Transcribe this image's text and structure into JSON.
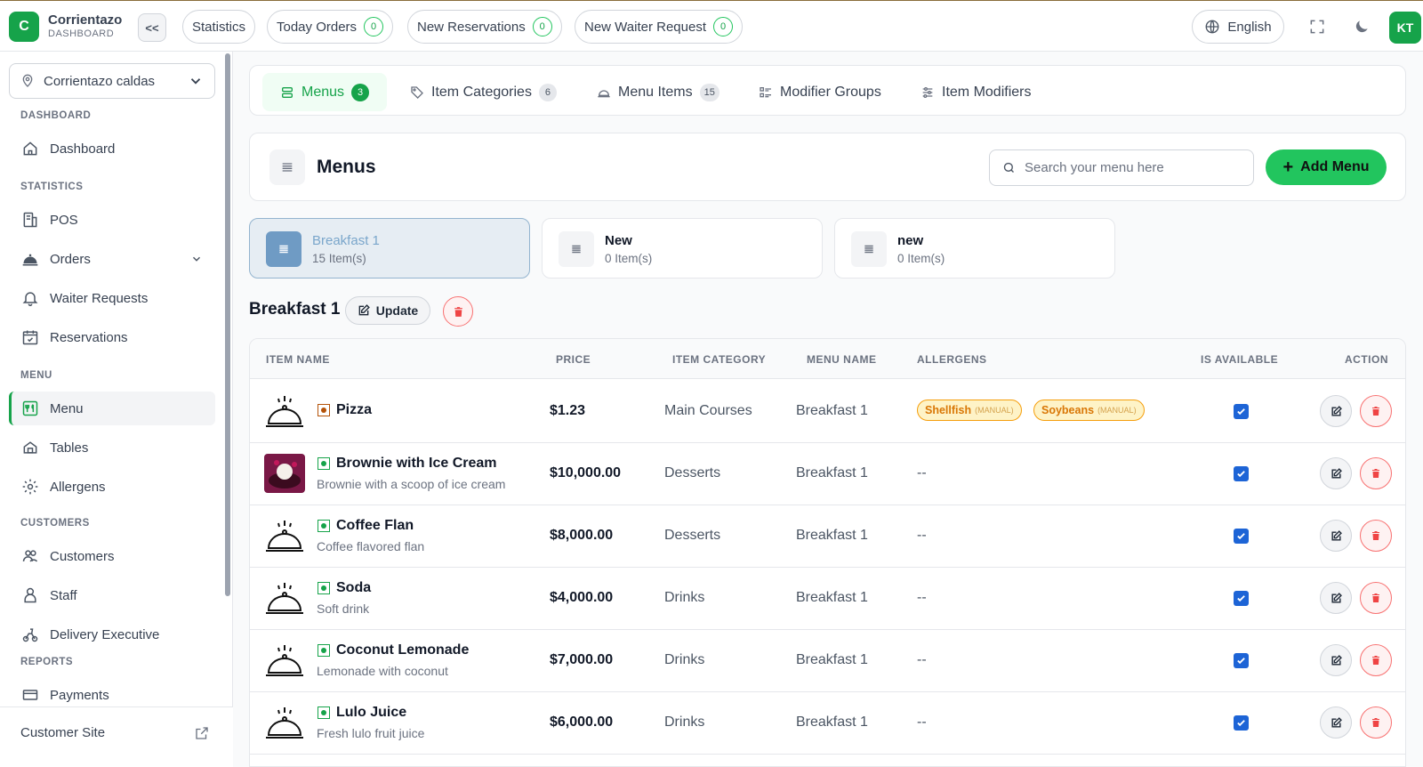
{
  "app": {
    "logo_letter": "C",
    "name": "Corrientazo",
    "subtitle": "DASHBOARD",
    "collapse_label": "<<",
    "accent": "#16a34a"
  },
  "top_pills": [
    {
      "label": "Statistics"
    },
    {
      "label": "Today Orders",
      "count": "0"
    },
    {
      "label": "New Reservations",
      "count": "0"
    },
    {
      "label": "New Waiter Request",
      "count": "0"
    }
  ],
  "language": "English",
  "user_initials": "KT",
  "branch": "Corrientazo caldas",
  "sidebar": {
    "sections": [
      "DASHBOARD",
      "STATISTICS",
      "MENU",
      "CUSTOMERS",
      "REPORTS"
    ],
    "items": [
      {
        "label": "Dashboard",
        "icon": "home-icon"
      },
      {
        "label": "POS",
        "icon": "pos-icon"
      },
      {
        "label": "Orders",
        "icon": "cloche-icon"
      },
      {
        "label": "Waiter Requests",
        "icon": "bell-icon"
      },
      {
        "label": "Reservations",
        "icon": "calendar-icon"
      },
      {
        "label": "Menu",
        "icon": "menu-icon"
      },
      {
        "label": "Tables",
        "icon": "tables-icon"
      },
      {
        "label": "Allergens",
        "icon": "gear-icon"
      },
      {
        "label": "Customers",
        "icon": "customers-icon"
      },
      {
        "label": "Staff",
        "icon": "staff-icon"
      },
      {
        "label": "Delivery Executive",
        "icon": "delivery-icon"
      },
      {
        "label": "Payments",
        "icon": "payments-icon"
      }
    ],
    "footer": "Customer Site"
  },
  "tabs": [
    {
      "label": "Menus",
      "count": "3"
    },
    {
      "label": "Item Categories",
      "count": "6"
    },
    {
      "label": "Menu Items",
      "count": "15"
    },
    {
      "label": "Modifier Groups"
    },
    {
      "label": "Item Modifiers"
    }
  ],
  "page": {
    "title": "Menus",
    "search_placeholder": "Search your menu here",
    "add_label": "Add Menu"
  },
  "menus": [
    {
      "name": "Breakfast 1",
      "items": "15 Item(s)"
    },
    {
      "name": "New",
      "items": "0 Item(s)"
    },
    {
      "name": "new",
      "items": "0 Item(s)"
    }
  ],
  "selected_menu": {
    "title": "Breakfast 1",
    "update_label": "Update"
  },
  "table": {
    "headers": [
      "ITEM NAME",
      "PRICE",
      "ITEM CATEGORY",
      "MENU NAME",
      "ALLERGENS",
      "IS AVAILABLE",
      "ACTION"
    ],
    "rows": [
      {
        "name": "Pizza",
        "desc": "",
        "price": "$1.23",
        "category": "Main Courses",
        "menu": "Breakfast 1",
        "allergens": [
          {
            "name": "Shellfish",
            "tag": "(MANUAL)"
          },
          {
            "name": "Soybeans",
            "tag": "(MANUAL)"
          }
        ],
        "empty": "",
        "veg": "#b45309",
        "available": true
      },
      {
        "name": "Brownie with Ice Cream",
        "desc": "Brownie with a scoop of ice cream",
        "price": "$10,000.00",
        "category": "Desserts",
        "menu": "Breakfast 1",
        "allergens": [],
        "empty": "--",
        "veg": "#16a34a",
        "available": true
      },
      {
        "name": "Coffee Flan",
        "desc": "Coffee flavored flan",
        "price": "$8,000.00",
        "category": "Desserts",
        "menu": "Breakfast 1",
        "allergens": [],
        "empty": "--",
        "veg": "#16a34a",
        "available": true
      },
      {
        "name": "Soda",
        "desc": "Soft drink",
        "price": "$4,000.00",
        "category": "Drinks",
        "menu": "Breakfast 1",
        "allergens": [],
        "empty": "--",
        "veg": "#16a34a",
        "available": true
      },
      {
        "name": "Coconut Lemonade",
        "desc": "Lemonade with coconut",
        "price": "$7,000.00",
        "category": "Drinks",
        "menu": "Breakfast 1",
        "allergens": [],
        "empty": "--",
        "veg": "#16a34a",
        "available": true
      },
      {
        "name": "Lulo Juice",
        "desc": "Fresh lulo fruit juice",
        "price": "$6,000.00",
        "category": "Drinks",
        "menu": "Breakfast 1",
        "allergens": [],
        "empty": "--",
        "veg": "#16a34a",
        "available": true
      }
    ]
  }
}
